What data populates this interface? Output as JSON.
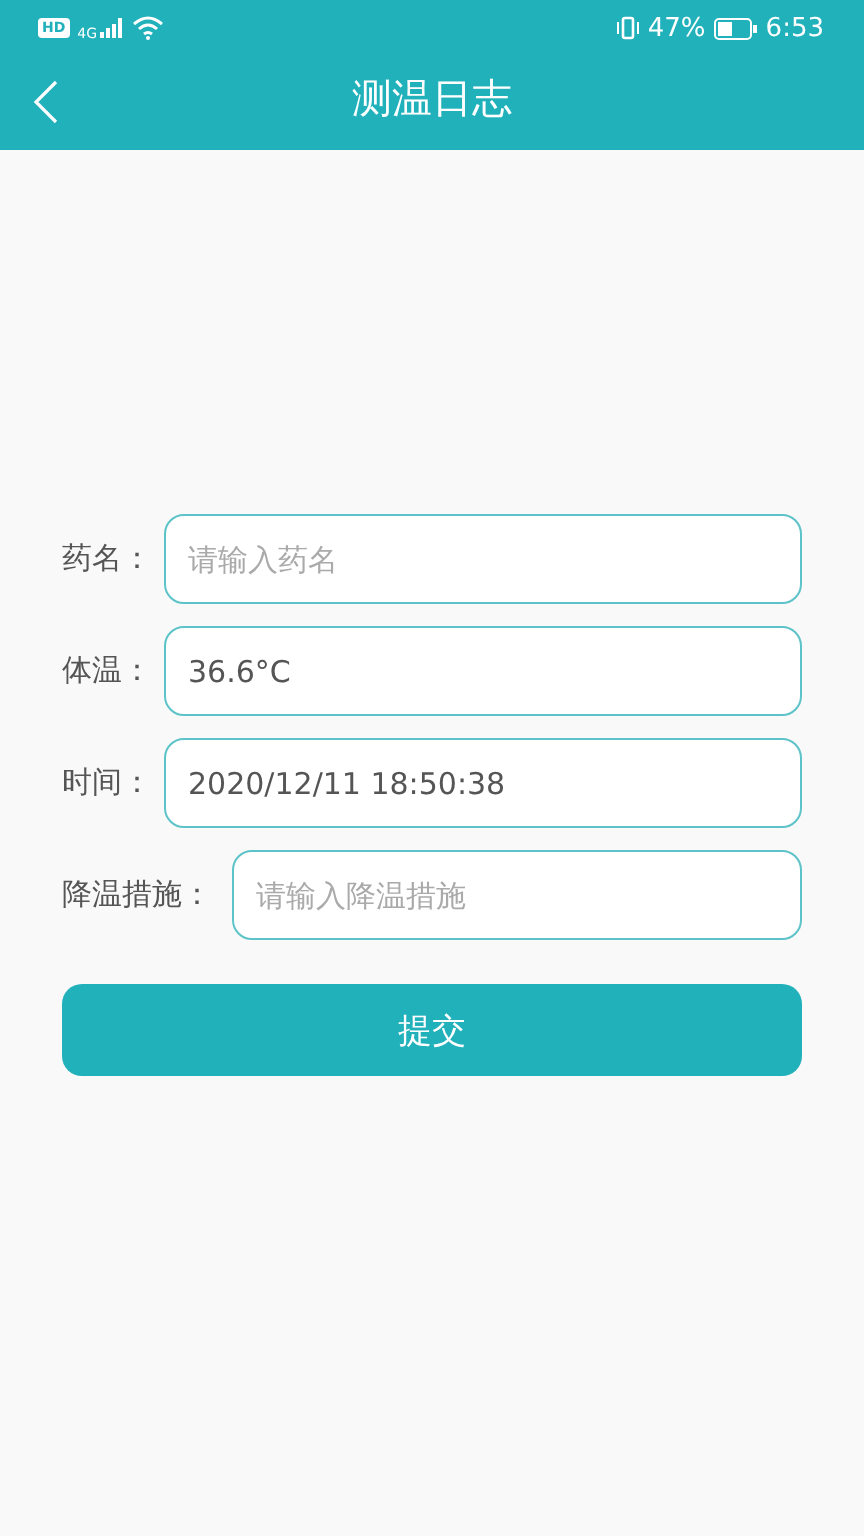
{
  "status_bar": {
    "hd": "HD",
    "network": "4G",
    "battery_percent": "47%",
    "time": "6:53"
  },
  "header": {
    "title": "测温日志"
  },
  "form": [
    {
      "label": "药名：",
      "placeholder": "请输入药名"
    },
    {
      "label": "体温：",
      "value": "36.6°C"
    },
    {
      "label": "时间：",
      "value": "2020/12/11 18:50:38"
    },
    {
      "label": "降温措施：",
      "placeholder": "请输入降温措施"
    }
  ],
  "submit_button": "提交"
}
